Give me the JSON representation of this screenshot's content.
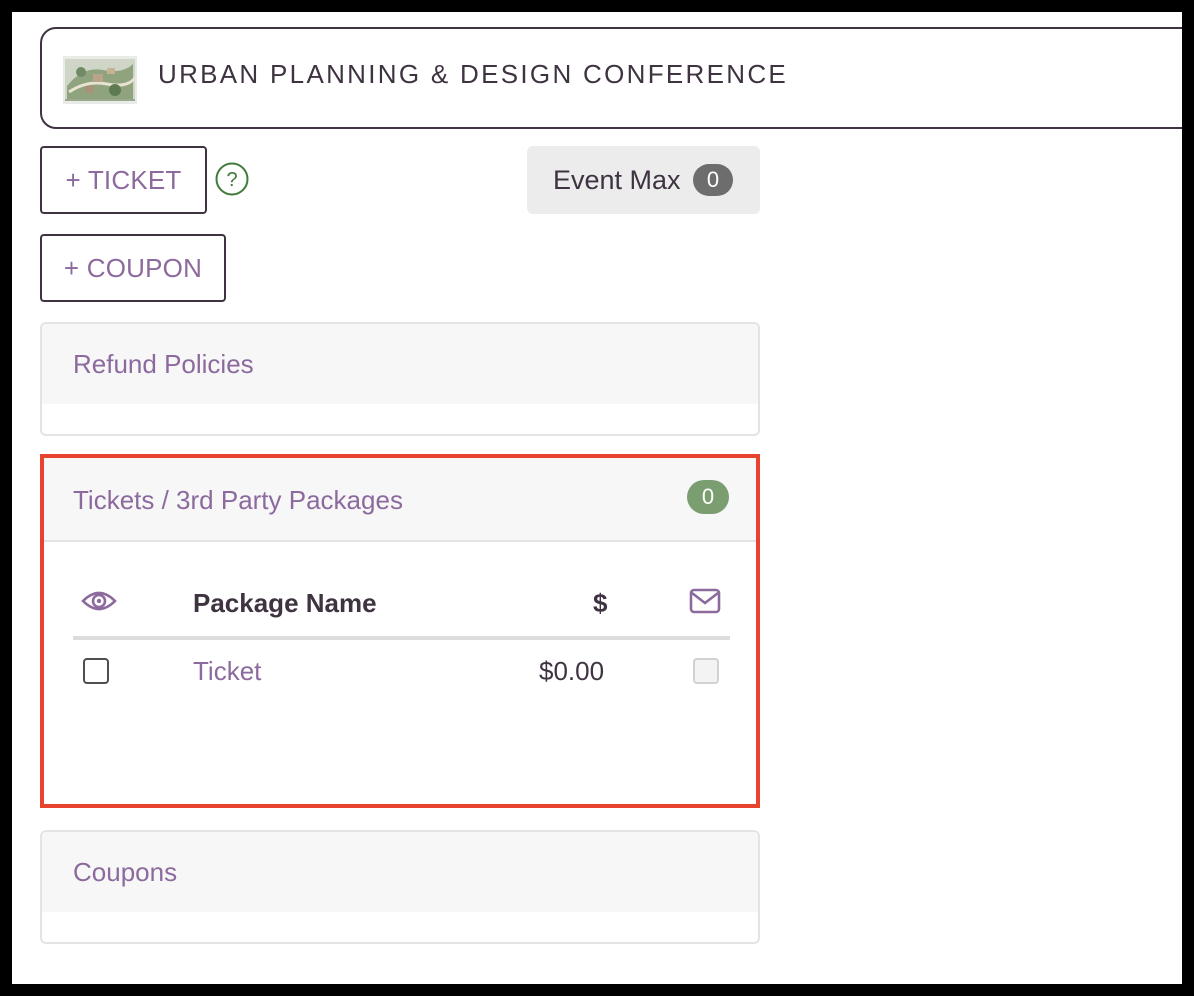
{
  "event": {
    "title": "URBAN PLANNING & DESIGN CONFERENCE",
    "thumbnail_icon": "urban-map-thumbnail"
  },
  "actions": {
    "add_ticket_label": "+ TICKET",
    "add_coupon_label": "+ COUPON",
    "help_icon": "question-circle-icon",
    "help_glyph": "?"
  },
  "event_max": {
    "label": "Event Max",
    "value": "0"
  },
  "panels": {
    "refund": {
      "title": "Refund Policies"
    },
    "tickets": {
      "title": "Tickets / 3rd Party Packages",
      "count": "0",
      "columns": {
        "visibility_icon": "eye-icon",
        "name": "Package Name",
        "price": "$",
        "email_icon": "envelope-icon"
      },
      "rows": [
        {
          "visible": false,
          "name": "Ticket",
          "price": "$0.00",
          "email": false
        }
      ]
    },
    "coupons": {
      "title": "Coupons"
    }
  },
  "colors": {
    "accent_purple": "#8c6a9e",
    "dark_text": "#3f3342",
    "badge_green": "#7a9e70",
    "badge_gray": "#6d6d6d",
    "highlight_red": "#e8432e",
    "help_green": "#3f7a3a"
  }
}
